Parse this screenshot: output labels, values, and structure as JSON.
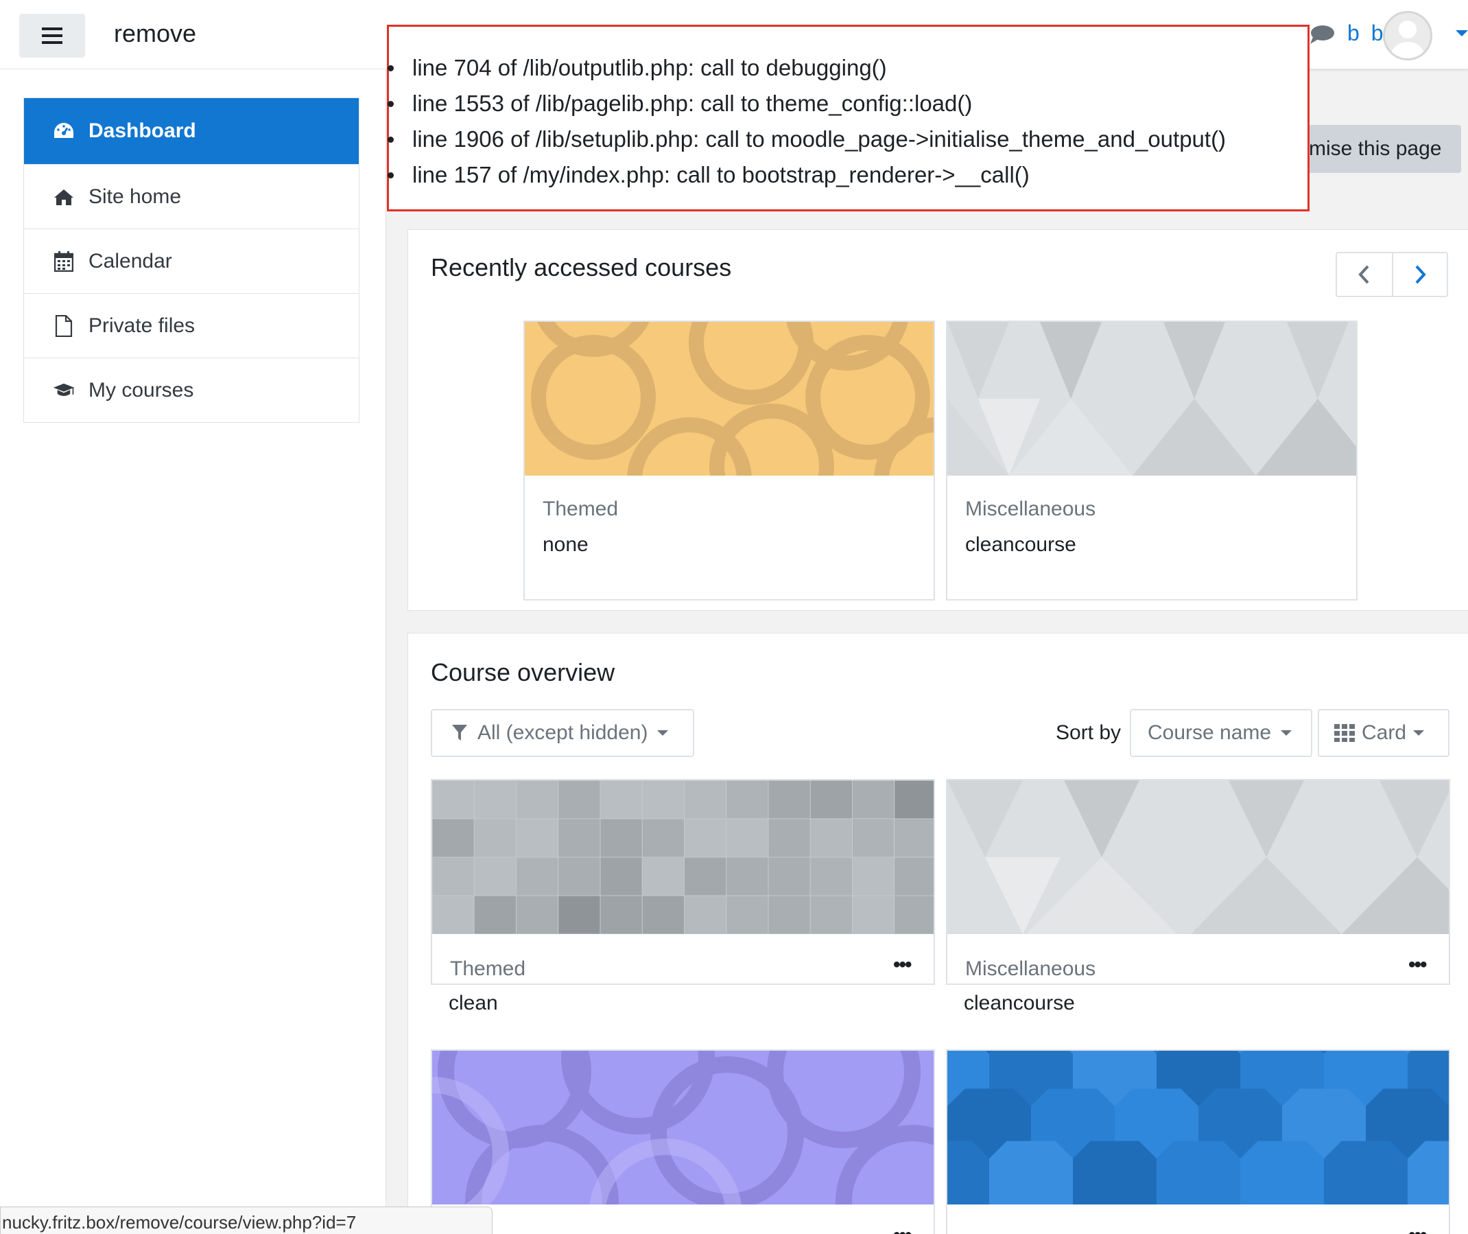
{
  "navbar": {
    "site_name": "remove",
    "user_name": "b b"
  },
  "sidebar": {
    "items": [
      {
        "label": "Dashboard",
        "icon": "dashboard-icon",
        "active": true
      },
      {
        "label": "Site home",
        "icon": "home-icon"
      },
      {
        "label": "Calendar",
        "icon": "calendar-icon"
      },
      {
        "label": "Private files",
        "icon": "file-icon"
      },
      {
        "label": "My courses",
        "icon": "graduation-cap-icon"
      }
    ]
  },
  "header": {
    "customise_label": "mise this page"
  },
  "debug": {
    "lines": [
      "line 704 of /lib/outputlib.php: call to debugging()",
      "line 1553 of /lib/pagelib.php: call to theme_config::load()",
      "line 1906 of /lib/setuplib.php: call to moodle_page->initialise_theme_and_output()",
      "line 157 of /my/index.php: call to bootstrap_renderer->__call()"
    ]
  },
  "recent": {
    "title": "Recently accessed courses",
    "courses": [
      {
        "category": "Themed",
        "name": "none",
        "pattern": "circles-orange"
      },
      {
        "category": "Miscellaneous",
        "name": "cleancourse",
        "pattern": "triangles-grey"
      }
    ]
  },
  "overview": {
    "title": "Course overview",
    "filter_label": "All (except hidden)",
    "sort_by_label": "Sort by",
    "sort_value": "Course name",
    "view_value": "Card",
    "courses": [
      {
        "category": "Themed",
        "name": "clean",
        "pattern": "squares-grey"
      },
      {
        "category": "Miscellaneous",
        "name": "cleancourse",
        "pattern": "triangles-grey"
      },
      {
        "category": "",
        "name": "",
        "pattern": "circles-purple"
      },
      {
        "category": "",
        "name": "",
        "pattern": "octagons-blue"
      }
    ],
    "more_label": "•••"
  },
  "status_bar": {
    "url": "nucky.fritz.box/remove/course/view.php?id=7"
  },
  "colors": {
    "brand": "#1177d1",
    "debug_border": "#e03226"
  }
}
